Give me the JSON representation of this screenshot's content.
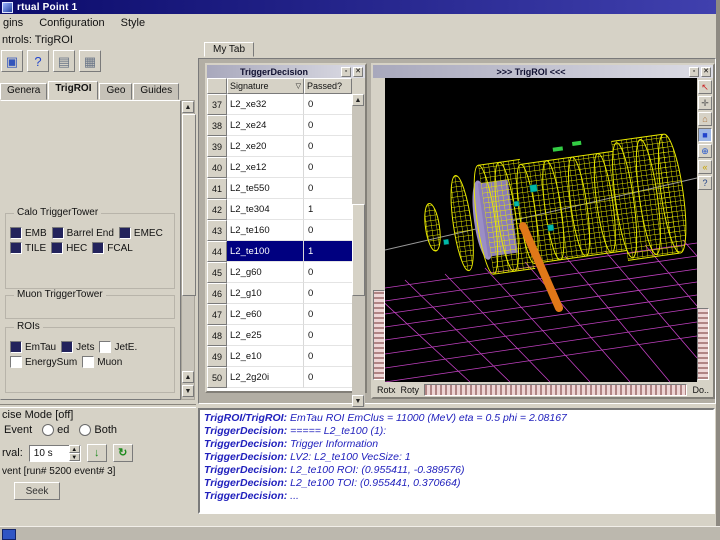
{
  "window": {
    "title": "rtual Point 1",
    "menus": [
      "gins",
      "Configuration",
      "Style"
    ],
    "controls_label": "ntrols: TrigROI"
  },
  "toolbar": {
    "buttons": [
      {
        "name": "window-icon",
        "glyph": "▣",
        "color": "#3355bb"
      },
      {
        "name": "help-icon",
        "glyph": "?",
        "color": "#2244cc"
      },
      {
        "name": "display-icon",
        "glyph": "▤",
        "color": "#6a7688"
      },
      {
        "name": "grid-icon",
        "glyph": "▦",
        "color": "#6a7688"
      }
    ]
  },
  "left_panel": {
    "tabs": [
      {
        "label": "Genera",
        "active": false
      },
      {
        "label": "TrigROI",
        "active": true
      },
      {
        "label": "Geo",
        "active": false
      },
      {
        "label": "Guides",
        "active": false
      }
    ],
    "calo_group": {
      "title": "Calo TriggerTower",
      "items": [
        {
          "label": "EMB",
          "checked": true
        },
        {
          "label": "Barrel End",
          "checked": true
        },
        {
          "label": "EMEC",
          "checked": true
        },
        {
          "label": "TILE",
          "checked": true
        },
        {
          "label": "HEC",
          "checked": true
        },
        {
          "label": "FCAL",
          "checked": true
        }
      ]
    },
    "muon_group": {
      "title": "Muon TriggerTower"
    },
    "roi_group": {
      "title": "ROIs",
      "items": [
        {
          "label": "EmTau",
          "checked": true
        },
        {
          "label": "Jets",
          "checked": true
        },
        {
          "label": "JetE.",
          "checked": false
        },
        {
          "label": "EnergySum",
          "checked": false
        },
        {
          "label": "Muon",
          "checked": false
        }
      ]
    }
  },
  "event_controls": {
    "mode_label": "cise Mode [off]",
    "event_label": "Event",
    "radios": [
      {
        "label": "ed",
        "checked": false
      },
      {
        "label": "Both",
        "checked": false
      }
    ],
    "interval_label": "rval:",
    "interval_value": "10 s",
    "prev_glyph": "↓",
    "next_glyph": "↻",
    "event_info": "vent [run# 5200 event# 3]",
    "seek_label": "Seek"
  },
  "workspace": {
    "tab_label": "My Tab",
    "trigger_window": {
      "title": "TriggerDecision",
      "columns": {
        "signature": "Signature",
        "passed": "Passed?"
      },
      "sort_indicator": "▽",
      "rows": [
        {
          "num": "37",
          "signature": "L2_xe32",
          "passed": "0",
          "selected": false
        },
        {
          "num": "38",
          "signature": "L2_xe24",
          "passed": "0",
          "selected": false
        },
        {
          "num": "39",
          "signature": "L2_xe20",
          "passed": "0",
          "selected": false
        },
        {
          "num": "40",
          "signature": "L2_xe12",
          "passed": "0",
          "selected": false
        },
        {
          "num": "41",
          "signature": "L2_te550",
          "passed": "0",
          "selected": false
        },
        {
          "num": "42",
          "signature": "L2_te304",
          "passed": "1",
          "selected": false
        },
        {
          "num": "43",
          "signature": "L2_te160",
          "passed": "0",
          "selected": false
        },
        {
          "num": "44",
          "signature": "L2_te100",
          "passed": "1",
          "selected": true
        },
        {
          "num": "45",
          "signature": "L2_g60",
          "passed": "0",
          "selected": false
        },
        {
          "num": "46",
          "signature": "L2_g10",
          "passed": "0",
          "selected": false
        },
        {
          "num": "47",
          "signature": "L2_e60",
          "passed": "0",
          "selected": false
        },
        {
          "num": "48",
          "signature": "L2_e25",
          "passed": "0",
          "selected": false
        },
        {
          "num": "49",
          "signature": "L2_e10",
          "passed": "0",
          "selected": false
        },
        {
          "num": "50",
          "signature": "L2_2g20i",
          "passed": "0",
          "selected": false
        }
      ]
    },
    "viewer_window": {
      "title": ">>> TrigROI <<<",
      "wheel_labels": {
        "rotx": "Rotx",
        "roty": "Roty",
        "dolly": "Do.."
      },
      "icons": [
        {
          "name": "pick-arrow-icon",
          "glyph": "↖",
          "color": "#cc2222",
          "active": false
        },
        {
          "name": "view-hand-icon",
          "glyph": "✛",
          "color": "#555555",
          "active": false
        },
        {
          "name": "home-icon",
          "glyph": "⌂",
          "color": "#a9743f",
          "active": false
        },
        {
          "name": "set-home-icon",
          "glyph": "■",
          "color": "#2244cc",
          "active": true
        },
        {
          "name": "view-all-icon",
          "glyph": "⊕",
          "color": "#2255cc",
          "active": false
        },
        {
          "name": "seek-icon",
          "glyph": "«",
          "color": "#c9a400",
          "active": false
        },
        {
          "name": "viewer-help-icon",
          "glyph": "?",
          "color": "#224488",
          "active": false
        }
      ]
    }
  },
  "messages": [
    {
      "prefix": "TrigROI/TrigROI:",
      "text": " EmTau ROI EmClus = 11000 (MeV) eta = 0.5 phi = 2.08167"
    },
    {
      "prefix": "TriggerDecision:",
      "text": " ===== L2_te100 (1):"
    },
    {
      "prefix": "TriggerDecision:",
      "text": " Trigger Information"
    },
    {
      "prefix": "TriggerDecision:",
      "text": " LV2: L2_te100 VecSize: 1"
    },
    {
      "prefix": "TriggerDecision:",
      "text": " L2_te100 ROI: (0.955411, -0.389576)"
    },
    {
      "prefix": "TriggerDecision:",
      "text": " L2_te100 TOI: (0.955441, 0.370664)"
    },
    {
      "prefix": "TriggerDecision:",
      "text": " ..."
    }
  ],
  "scene_colors": {
    "detector": "#e8e800",
    "grid": "#cc44cc",
    "track": "#e07818",
    "hits": "#00b8a8",
    "inner_disc": "#9b8ec4",
    "background": "#000000"
  }
}
